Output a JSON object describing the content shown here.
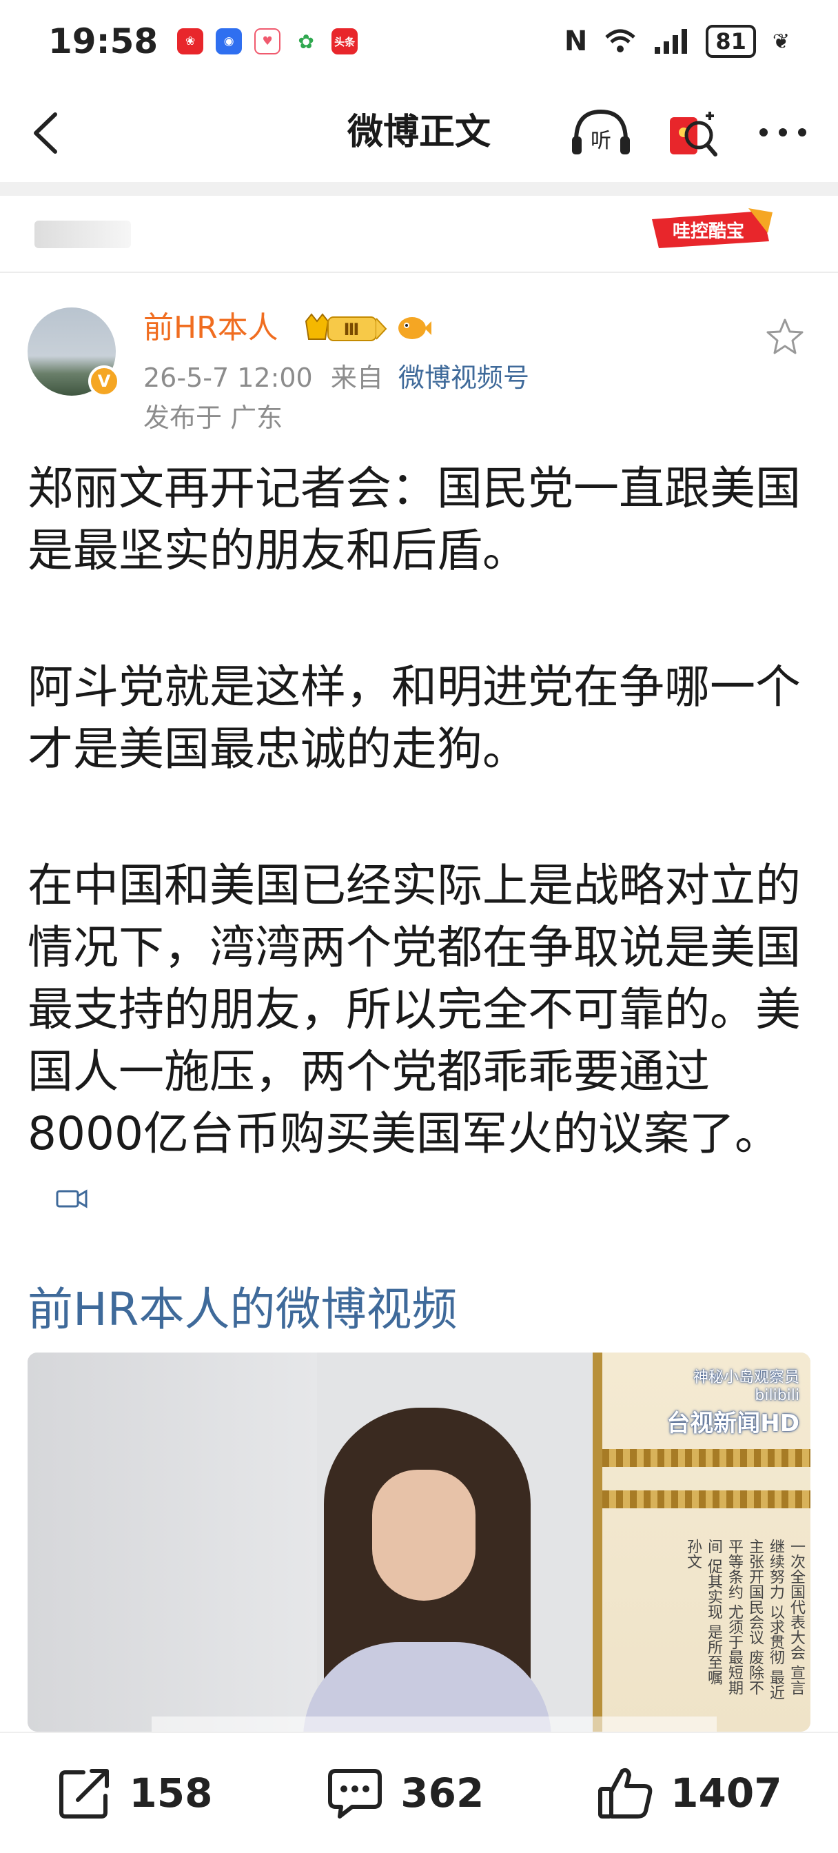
{
  "status_bar": {
    "time": "19:58",
    "app_notifications": [
      {
        "icon": "app-red-icon",
        "color": "#e8262b",
        "label": ""
      },
      {
        "icon": "app-blue-icon",
        "color": "#2f6ff0",
        "label": ""
      },
      {
        "icon": "app-heart-icon",
        "color": "#f05a6e",
        "label": ""
      },
      {
        "icon": "mobile-icon",
        "color": "#2fa84f",
        "label": ""
      },
      {
        "icon": "toutiao-icon",
        "color": "#e8262b",
        "label": "头条"
      }
    ],
    "battery": "81",
    "icons": [
      "nfc-icon",
      "wifi-icon",
      "signal-icon",
      "battery-icon",
      "leaf-icon"
    ]
  },
  "nav": {
    "title": "微博正文",
    "listen_label": "听",
    "icons": [
      "back-icon",
      "listen-icon",
      "redpacket-icon",
      "more-icon"
    ]
  },
  "banner": {
    "badge_text": "哇控酷宝"
  },
  "post": {
    "username": "前HR本人",
    "level_badge": "Ⅲ",
    "verify_mark": "V",
    "timestamp": "26-5-7 12:00",
    "source_prefix": "来自",
    "source": "微博视频号",
    "location": "发布于 广东",
    "paragraphs": [
      "郑丽文再开记者会：国民党一直跟美国是最坚实的朋友和后盾。",
      "阿斗党就是这样，和明进党在争哪一个才是美国最忠诚的走狗。",
      "在中国和美国已经实际上是战略对立的情况下，湾湾两个党都在争取说是美国最支持的朋友，所以完全不可靠的。美国人一施压，两个党都乖乖要通过8000亿台币购买美国军火的议案了。"
    ],
    "video_link": "前HR本人的微博视频"
  },
  "video": {
    "watermark_top": "神秘小岛观察员",
    "watermark_brand": "bilibili",
    "watermark_main": "台视新闻HD",
    "scroll_text": "一次全国代表大会 宣言 继续努力 以求贯彻 最近主张开国民会议 废除不平等条约 尤须于最短期间 促其实现 是所至嘱 孙文"
  },
  "actions": {
    "share_count": "158",
    "comment_count": "362",
    "like_count": "1407"
  },
  "colors": {
    "username": "#f06d20",
    "link": "#3f6a9a",
    "meta": "#8c8c8c"
  }
}
